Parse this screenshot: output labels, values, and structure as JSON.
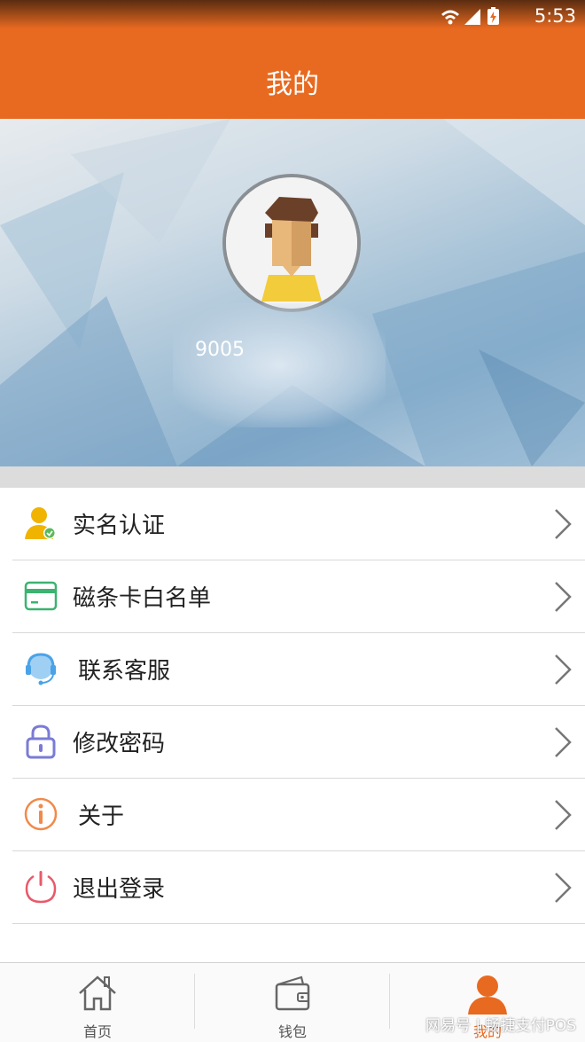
{
  "status_bar": {
    "time": "5:53"
  },
  "header": {
    "title": "我的"
  },
  "profile": {
    "username": "9005"
  },
  "menu": [
    {
      "label": "实名认证",
      "icon": "user-verified-icon",
      "color": "#f0b400"
    },
    {
      "label": "磁条卡白名单",
      "icon": "card-icon",
      "color": "#3cb371"
    },
    {
      "label": "联系客服",
      "icon": "headset-icon",
      "color": "#4aa3e8"
    },
    {
      "label": "修改密码",
      "icon": "lock-icon",
      "color": "#7b7bd6"
    },
    {
      "label": "关于",
      "icon": "info-icon",
      "color": "#f08a4a"
    },
    {
      "label": "退出登录",
      "icon": "power-icon",
      "color": "#e85a6a"
    }
  ],
  "bottom_nav": [
    {
      "label": "首页",
      "icon": "home-icon",
      "active": false
    },
    {
      "label": "钱包",
      "icon": "wallet-icon",
      "active": false
    },
    {
      "label": "我的",
      "icon": "person-icon",
      "active": true
    }
  ],
  "watermark": "网易号 | 畅捷支付POS",
  "colors": {
    "accent": "#e86a20"
  }
}
